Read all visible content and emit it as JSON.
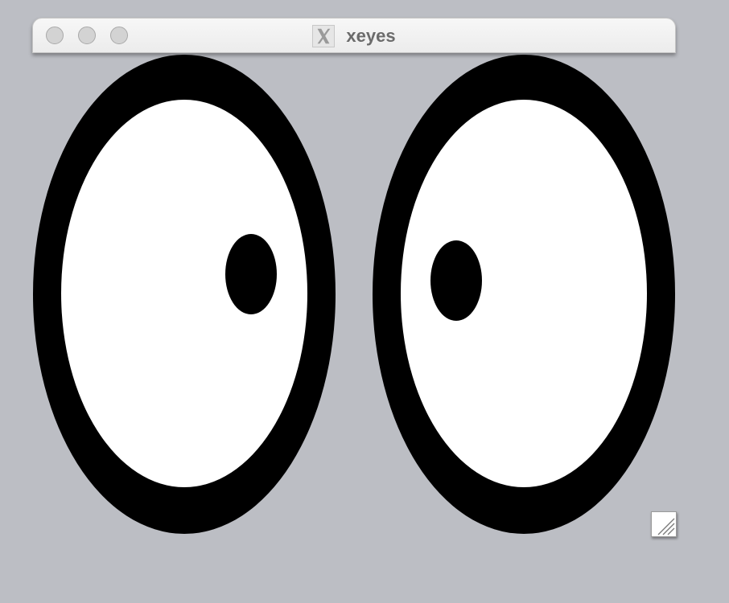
{
  "window": {
    "title": "xeyes",
    "app_icon": "x-window-icon"
  },
  "titlebar_buttons": [
    "close",
    "minimize",
    "zoom"
  ],
  "colors": {
    "desktop": "#bcbec4",
    "eye_outline": "#000000",
    "eye_white": "#ffffff",
    "pupil": "#000000"
  },
  "resize_handle_icon": "resize-grip-icon"
}
